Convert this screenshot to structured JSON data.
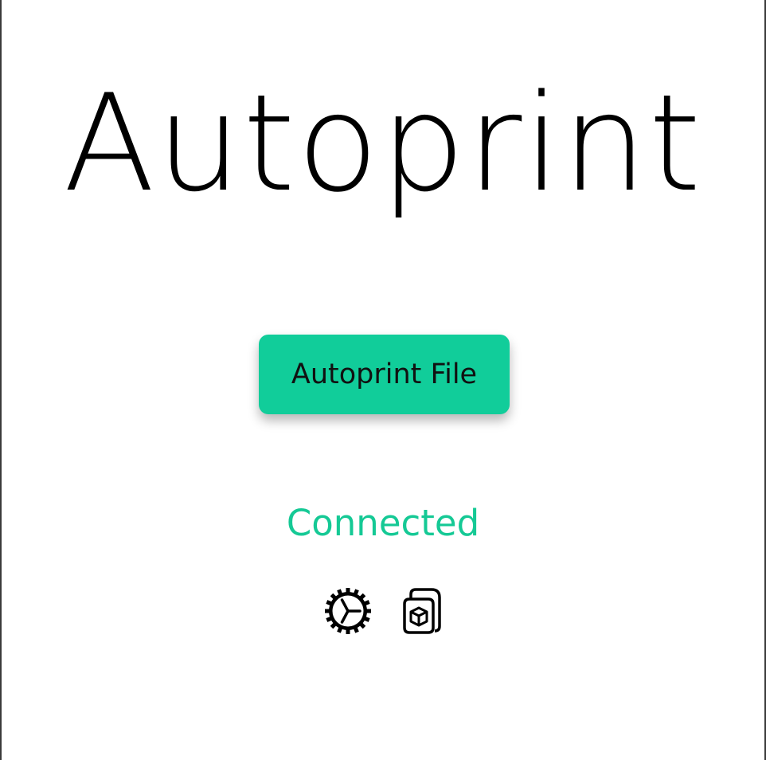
{
  "app": {
    "title": "Autoprint"
  },
  "main": {
    "primary_button_label": "Autoprint File",
    "status_text": "Connected",
    "status_color": "#15c995",
    "accent_color": "#11cd9a"
  },
  "toolbar": {
    "icons": [
      {
        "name": "settings-gear-icon"
      },
      {
        "name": "package-icon"
      }
    ]
  }
}
